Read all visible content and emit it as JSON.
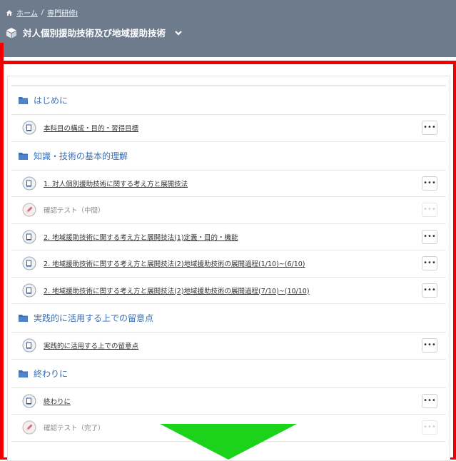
{
  "breadcrumb": {
    "home": "ホーム",
    "sep": "/",
    "course": "専門研修Ⅰ"
  },
  "page": {
    "title": "対人個別援助技術及び地域援助技術",
    "chevron": "chevron-down"
  },
  "more_label": "•••",
  "sections": [
    {
      "name": "はじめに",
      "items": [
        {
          "label": "本科目の構成・目的・習得目標",
          "icon": "book",
          "type": "link"
        }
      ]
    },
    {
      "name": "知識・技術の基本的理解",
      "items": [
        {
          "label": "1. 対人個別援助技術に関する考え方と展開技法",
          "icon": "book",
          "type": "link"
        },
        {
          "label": "確認テスト（中間）",
          "icon": "pencil",
          "type": "plain"
        },
        {
          "label": "2. 地域援助技術に関する考え方と展開技法(1)定義・目的・機能",
          "icon": "book",
          "type": "link"
        },
        {
          "label": "2. 地域援助技術に関する考え方と展開技法(2)地域援助技術の展開過程(1/10)~(6/10)",
          "icon": "book",
          "type": "link"
        },
        {
          "label": "2. 地域援助技術に関する考え方と展開技法(2)地域援助技術の展開過程(7/10)~(10/10)",
          "icon": "book",
          "type": "link"
        }
      ]
    },
    {
      "name": "実践的に活用する上での留意点",
      "items": [
        {
          "label": "実践的に活用する上での留意点",
          "icon": "book",
          "type": "link"
        }
      ]
    },
    {
      "name": "終わりに",
      "items": [
        {
          "label": "終わりに",
          "icon": "book",
          "type": "link"
        },
        {
          "label": "確認テスト（完了）",
          "icon": "pencil",
          "type": "plain"
        }
      ]
    }
  ],
  "colors": {
    "header_bg": "#6d7b8d",
    "section_text": "#3a6fb5",
    "highlight_red": "#f00000",
    "arrow_green": "#1bd31b"
  }
}
